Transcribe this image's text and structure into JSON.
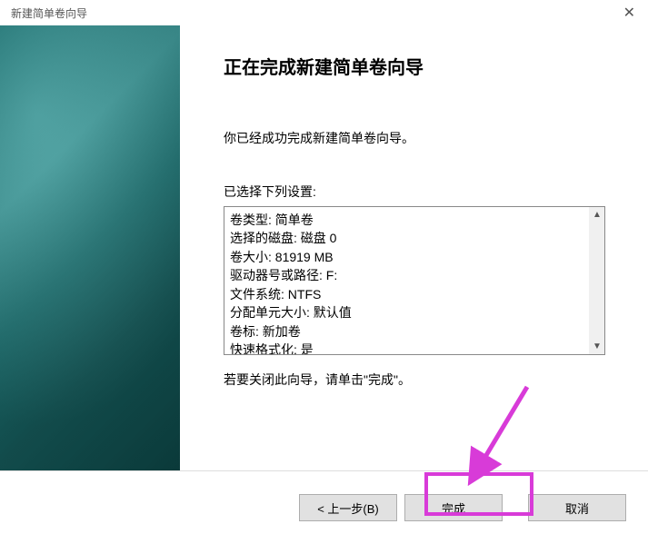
{
  "titlebar": {
    "title": "新建简单卷向导",
    "close_glyph": "✕"
  },
  "wizard": {
    "heading": "正在完成新建简单卷向导",
    "success_text": "你已经成功完成新建简单卷向导。",
    "settings_label": "已选择下列设置:",
    "settings_lines": "卷类型: 简单卷\n选择的磁盘: 磁盘 0\n卷大小: 81919 MB\n驱动器号或路径: F:\n文件系统: NTFS\n分配单元大小: 默认值\n卷标: 新加卷\n快速格式化: 是",
    "close_hint": "若要关闭此向导，请单击\"完成\"。"
  },
  "scroll": {
    "up": "▲",
    "down": "▼"
  },
  "buttons": {
    "back": "< 上一步(B)",
    "finish": "完成",
    "cancel": "取消"
  }
}
